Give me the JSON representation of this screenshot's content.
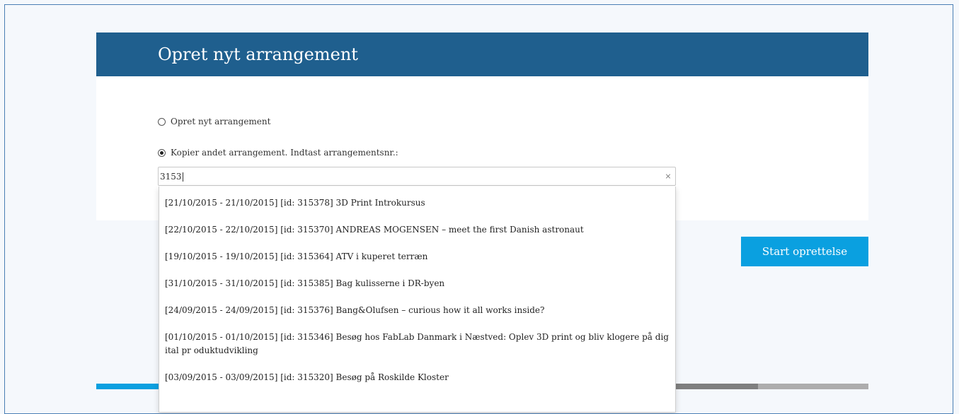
{
  "header": {
    "title": "Opret nyt arrangement"
  },
  "options": {
    "new_label": "Opret nyt arrangement",
    "new_checked": false,
    "copy_label": "Kopier andet arrangement. Indtast arrangementsnr.:",
    "copy_checked": true
  },
  "search": {
    "value": "3153",
    "clear": "×"
  },
  "start_button": {
    "label": "Start oprettelse"
  },
  "results": [
    "[21/10/2015 - 21/10/2015] [id: 315378] 3D Print Introkursus",
    "[22/10/2015 - 22/10/2015] [id: 315370] ANDREAS MOGENSEN – meet the first Danish astronaut",
    "[19/10/2015 - 19/10/2015] [id: 315364] ATV i kuperet terræn",
    "[31/10/2015 - 31/10/2015] [id: 315385] Bag kulisserne i DR-byen",
    "[24/09/2015 - 24/09/2015] [id: 315376] Bang&Olufsen – curious how it all works inside?",
    "[01/10/2015 - 01/10/2015] [id: 315346] Besøg hos FabLab Danmark i Næstved: Oplev 3D print og bliv klogere på digital pr oduktudvikling",
    "[03/09/2015 - 03/09/2015] [id: 315320] Besøg på Roskilde Kloster"
  ],
  "colors": {
    "header_bg": "#1f5f8e",
    "button_bg": "#0aa0e0"
  }
}
